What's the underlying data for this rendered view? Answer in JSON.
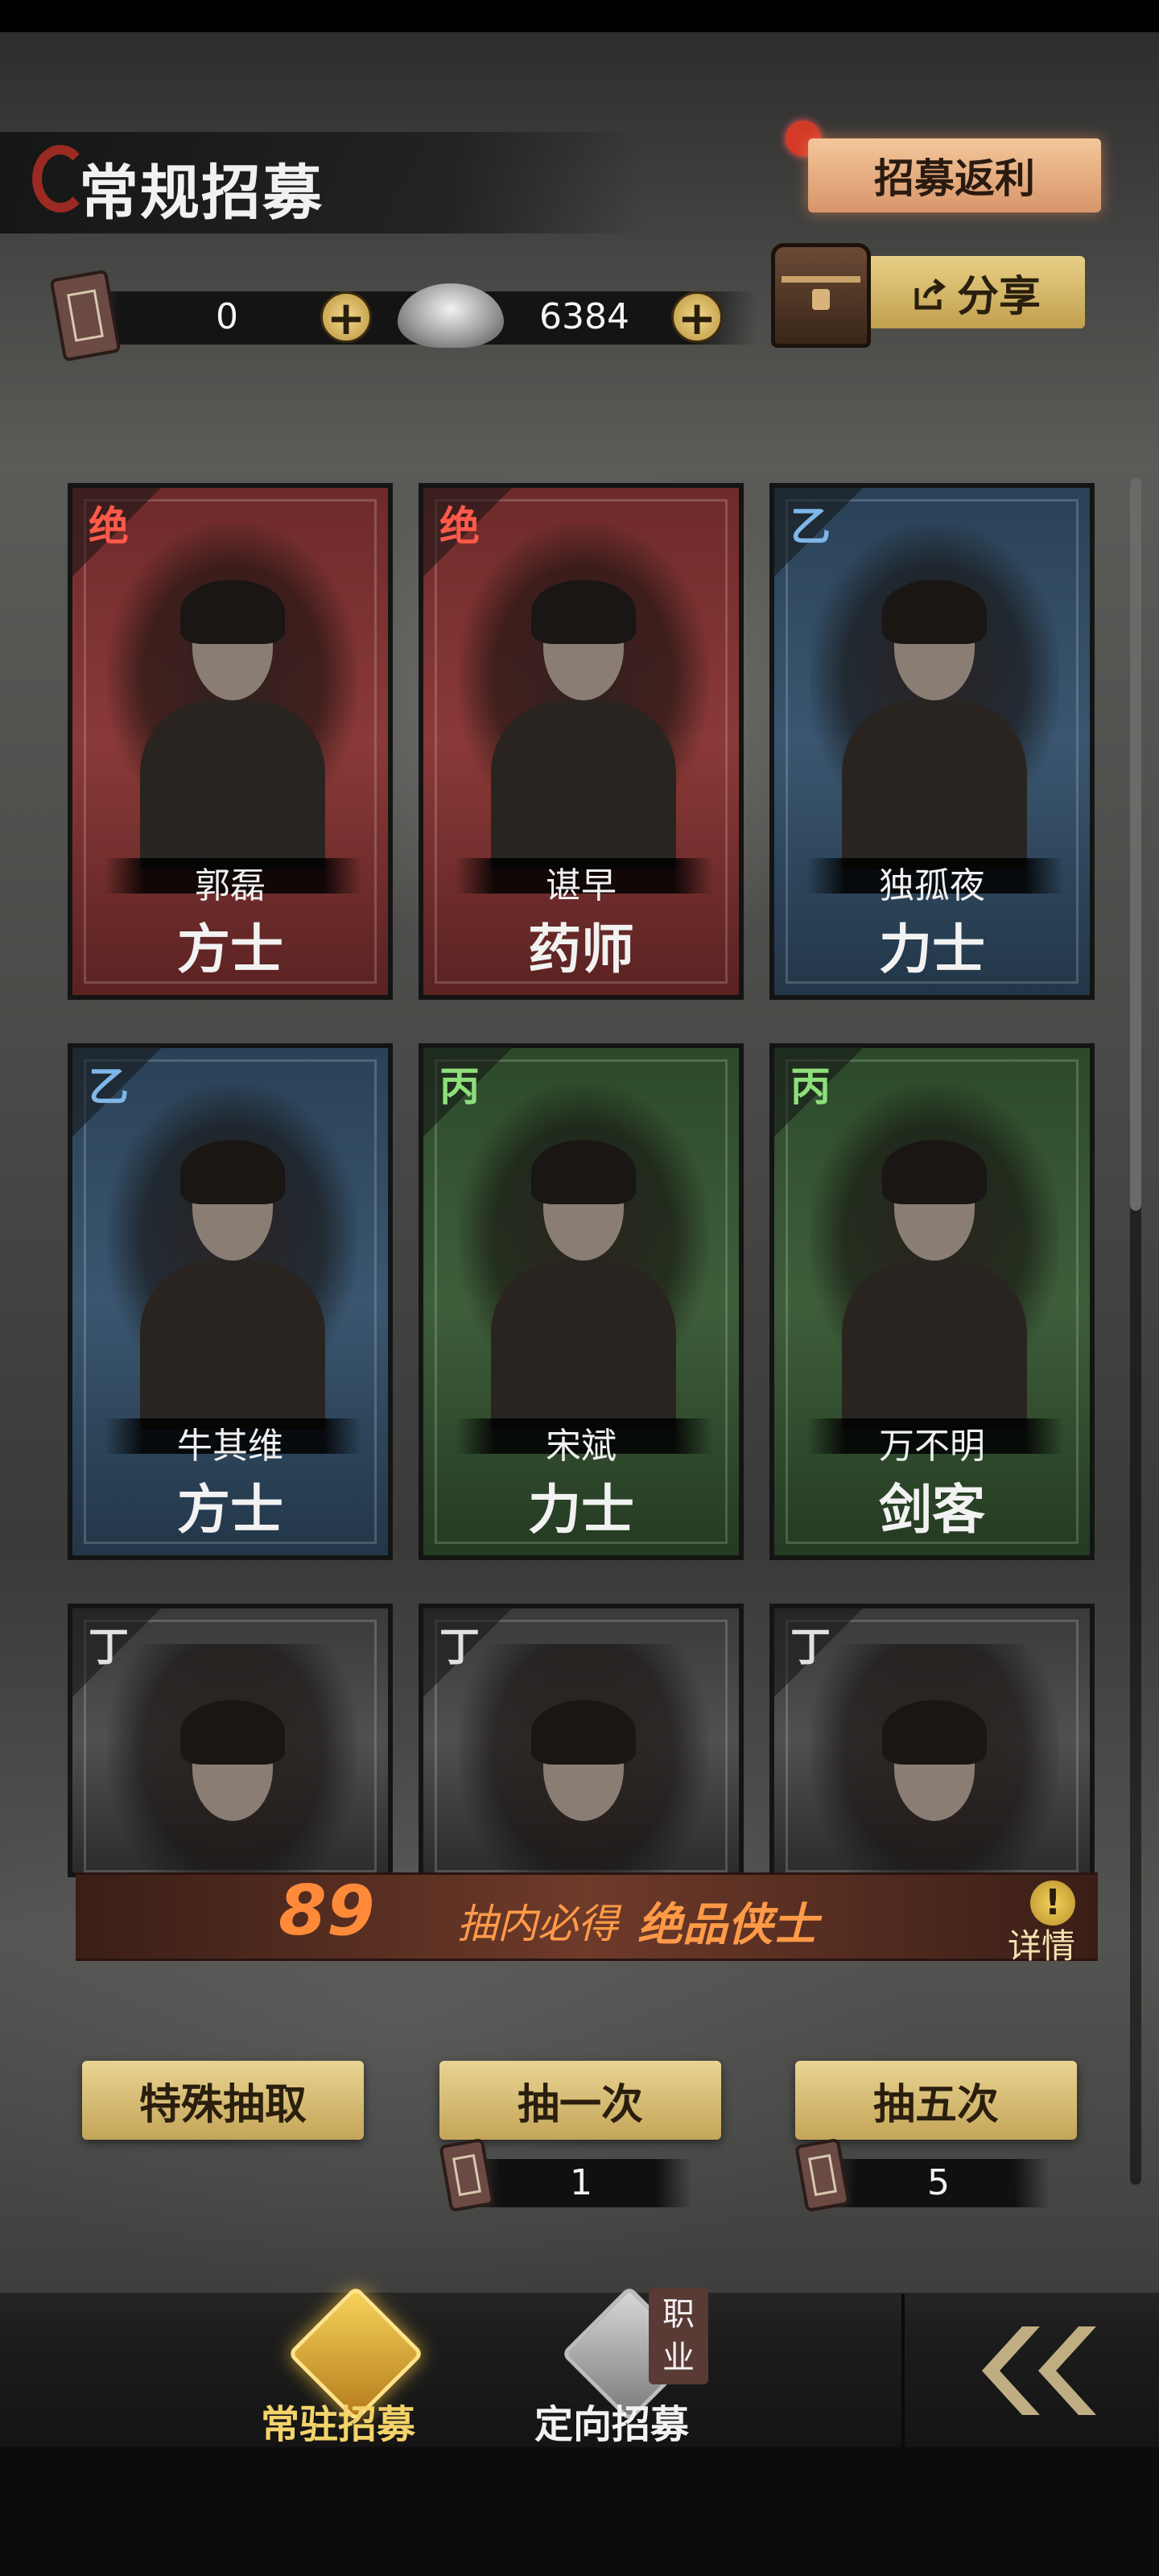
{
  "header": {
    "title": "常规招募",
    "rebate_label": "招募返利",
    "share_label": "分享"
  },
  "currency": {
    "token_count": "0",
    "silver_count": "6384",
    "add_symbol": "+"
  },
  "cards": [
    {
      "rank": "绝",
      "name": "郭磊",
      "class": "方士",
      "tier": "jue"
    },
    {
      "rank": "绝",
      "name": "谌早",
      "class": "药师",
      "tier": "jue"
    },
    {
      "rank": "乙",
      "name": "独孤夜",
      "class": "力士",
      "tier": "yi"
    },
    {
      "rank": "乙",
      "name": "牛其维",
      "class": "方士",
      "tier": "yi"
    },
    {
      "rank": "丙",
      "name": "宋斌",
      "class": "力士",
      "tier": "bing"
    },
    {
      "rank": "丙",
      "name": "万不明",
      "class": "剑客",
      "tier": "bing"
    },
    {
      "rank": "丁",
      "tier": "ding"
    },
    {
      "rank": "丁",
      "tier": "ding"
    },
    {
      "rank": "丁",
      "tier": "ding"
    }
  ],
  "banner": {
    "count": "89",
    "text_before": "抽内必得",
    "text_highlight": "绝品侠士",
    "detail_label": "详情",
    "detail_symbol": "!"
  },
  "draw": {
    "special_label": "特殊抽取",
    "once_label": "抽一次",
    "five_label": "抽五次",
    "once_cost": "1",
    "five_cost": "5"
  },
  "nav": {
    "regular_label": "常驻招募",
    "directed_label": "定向招募",
    "directed_tag": "职业",
    "back_symbol": "《"
  },
  "colors": {
    "accent_gold": "#c4a558",
    "rank_jue": "#ff5a4a",
    "rank_yi": "#7fb6e8",
    "rank_bing": "#8ee07a",
    "banner_text": "#ff9a48"
  }
}
